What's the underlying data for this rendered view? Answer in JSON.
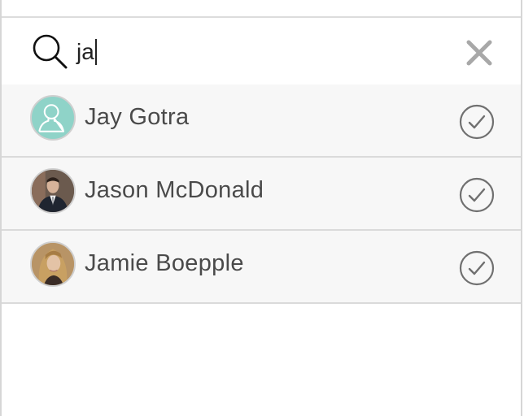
{
  "search": {
    "value": "ja",
    "icon": "search-icon",
    "clear_icon": "close-icon"
  },
  "results": [
    {
      "name": "Jay Gotra",
      "avatar": "default-avatar-icon",
      "selected": true
    },
    {
      "name": "Jason McDonald",
      "avatar": "photo",
      "selected": true
    },
    {
      "name": "Jamie Boepple",
      "avatar": "photo",
      "selected": true
    }
  ],
  "colors": {
    "avatar_default_bg": "#8fd3c8",
    "row_bg": "#f7f7f7",
    "text": "#4a4a4a",
    "check": "#707070"
  }
}
